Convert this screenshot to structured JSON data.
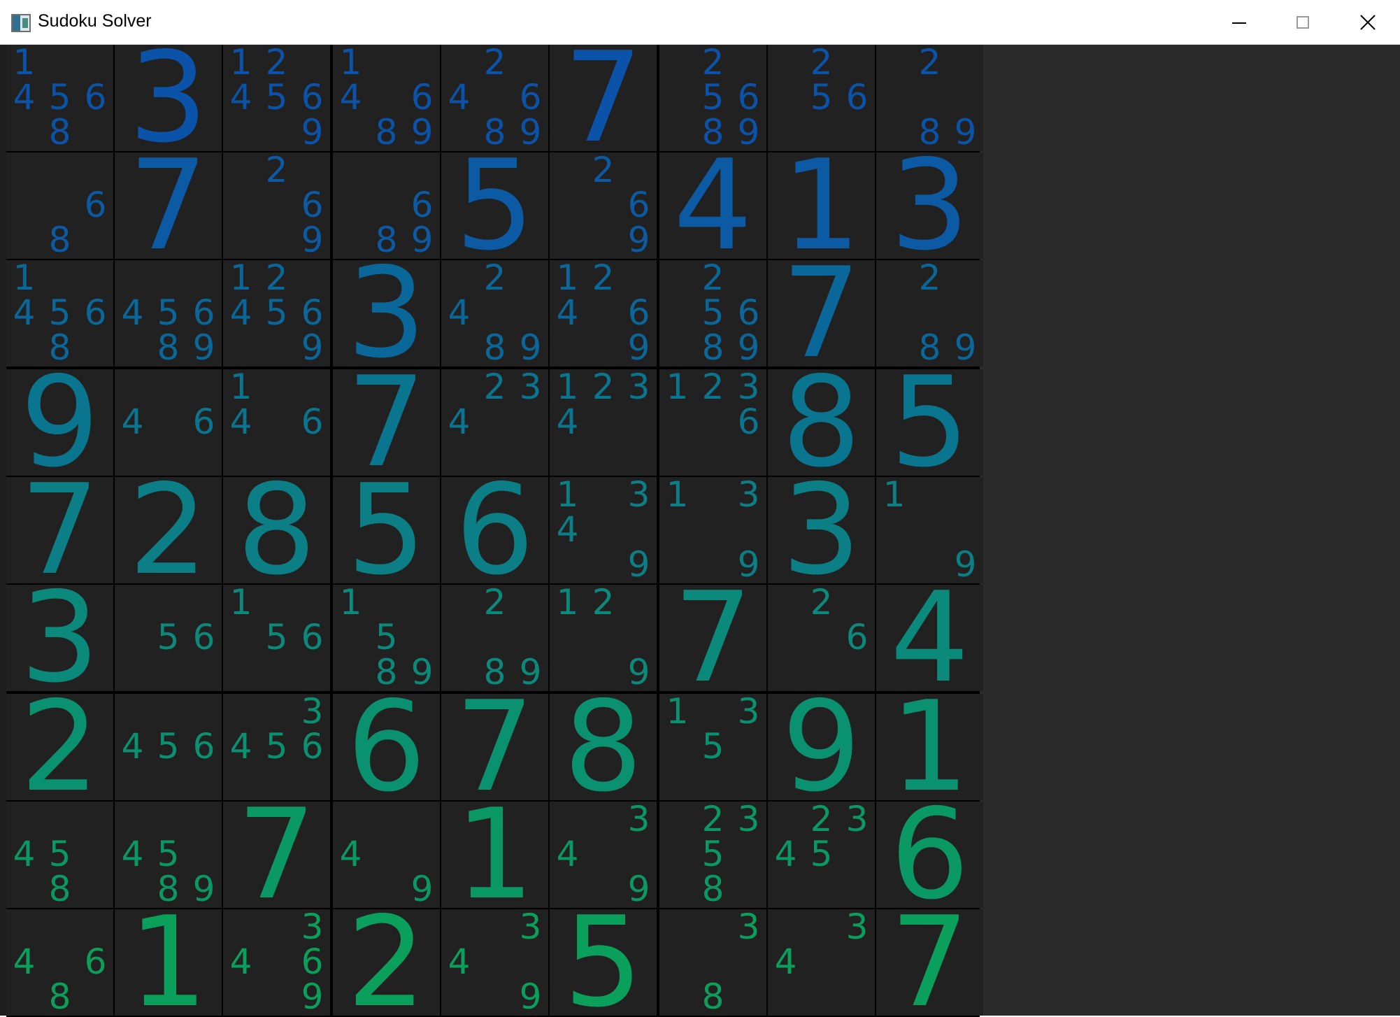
{
  "window": {
    "title": "Sudoku Solver",
    "icon": "sudoku-app-icon",
    "controls": [
      "minimize-icon",
      "maximize-icon",
      "close-icon"
    ]
  },
  "colors": {
    "row_palette": [
      "#0a53a8",
      "#0b5aa3",
      "#0a6799",
      "#0a758f",
      "#0b7f85",
      "#0b8a7b",
      "#0a9170",
      "#0a9865",
      "#0a9f5a"
    ],
    "cell_background": "#212121",
    "board_lines": "#000000",
    "background": "#2b2b2b"
  },
  "board": {
    "cells": [
      [
        {
          "cand": [
            4,
            5,
            6,
            8,
            1
          ]
        },
        {
          "v": 3
        },
        {
          "cand": [
            4,
            5,
            6,
            9,
            1,
            2
          ]
        },
        {
          "cand": [
            4,
            6,
            8,
            9,
            1
          ]
        },
        {
          "cand": [
            4,
            6,
            8,
            9,
            2
          ]
        },
        {
          "v": 7
        },
        {
          "cand": [
            5,
            6,
            8,
            9,
            2
          ]
        },
        {
          "cand": [
            5,
            6,
            2
          ]
        },
        {
          "cand": [
            8,
            9,
            2
          ]
        }
      ],
      [
        {
          "cand": [
            6,
            8
          ]
        },
        {
          "v": 7
        },
        {
          "cand": [
            6,
            9,
            2
          ]
        },
        {
          "cand": [
            6,
            8,
            9
          ]
        },
        {
          "v": 5
        },
        {
          "cand": [
            6,
            9,
            2
          ]
        },
        {
          "v": 4
        },
        {
          "v": 1
        },
        {
          "v": 3
        }
      ],
      [
        {
          "cand": [
            4,
            5,
            6,
            8,
            1
          ]
        },
        {
          "cand": [
            4,
            5,
            6,
            8,
            9
          ]
        },
        {
          "cand": [
            4,
            5,
            6,
            9,
            1,
            2
          ]
        },
        {
          "v": 3
        },
        {
          "cand": [
            4,
            8,
            9,
            2
          ]
        },
        {
          "cand": [
            4,
            6,
            9,
            1,
            2
          ]
        },
        {
          "cand": [
            5,
            6,
            8,
            9,
            2
          ]
        },
        {
          "v": 7
        },
        {
          "cand": [
            8,
            9,
            2
          ]
        }
      ],
      [
        {
          "v": 9
        },
        {
          "cand": [
            4,
            6
          ]
        },
        {
          "cand": [
            4,
            6,
            1
          ]
        },
        {
          "v": 7
        },
        {
          "cand": [
            4,
            2,
            3
          ]
        },
        {
          "cand": [
            4,
            1,
            2,
            3
          ]
        },
        {
          "cand": [
            6,
            1,
            2,
            3
          ]
        },
        {
          "v": 8
        },
        {
          "v": 5
        }
      ],
      [
        {
          "v": 7
        },
        {
          "v": 2
        },
        {
          "v": 8
        },
        {
          "v": 5
        },
        {
          "v": 6
        },
        {
          "cand": [
            4,
            9,
            1,
            3
          ]
        },
        {
          "cand": [
            9,
            1,
            3
          ]
        },
        {
          "v": 3
        },
        {
          "cand": [
            9,
            1
          ]
        }
      ],
      [
        {
          "v": 3
        },
        {
          "cand": [
            5,
            6
          ]
        },
        {
          "cand": [
            5,
            6,
            1
          ]
        },
        {
          "cand": [
            5,
            8,
            9,
            1
          ]
        },
        {
          "cand": [
            8,
            9,
            2
          ]
        },
        {
          "cand": [
            9,
            1,
            2
          ]
        },
        {
          "v": 7
        },
        {
          "cand": [
            6,
            2
          ]
        },
        {
          "v": 4
        }
      ],
      [
        {
          "v": 2
        },
        {
          "cand": [
            4,
            5,
            6
          ]
        },
        {
          "cand": [
            4,
            5,
            6,
            3
          ]
        },
        {
          "v": 6
        },
        {
          "v": 7
        },
        {
          "v": 8
        },
        {
          "cand": [
            5,
            1,
            3
          ]
        },
        {
          "v": 9
        },
        {
          "v": 1
        }
      ],
      [
        {
          "cand": [
            4,
            5,
            8
          ]
        },
        {
          "cand": [
            4,
            5,
            8,
            9
          ]
        },
        {
          "v": 7
        },
        {
          "cand": [
            4,
            9
          ]
        },
        {
          "v": 1
        },
        {
          "cand": [
            4,
            9,
            3
          ]
        },
        {
          "cand": [
            5,
            8,
            2,
            3
          ]
        },
        {
          "cand": [
            4,
            5,
            2,
            3
          ]
        },
        {
          "v": 6
        }
      ],
      [
        {
          "cand": [
            4,
            6,
            8
          ]
        },
        {
          "v": 1
        },
        {
          "cand": [
            4,
            6,
            9,
            3
          ]
        },
        {
          "v": 2
        },
        {
          "cand": [
            4,
            9,
            3
          ]
        },
        {
          "v": 5
        },
        {
          "cand": [
            8,
            3
          ]
        },
        {
          "cand": [
            4,
            3
          ]
        },
        {
          "v": 7
        }
      ]
    ]
  }
}
